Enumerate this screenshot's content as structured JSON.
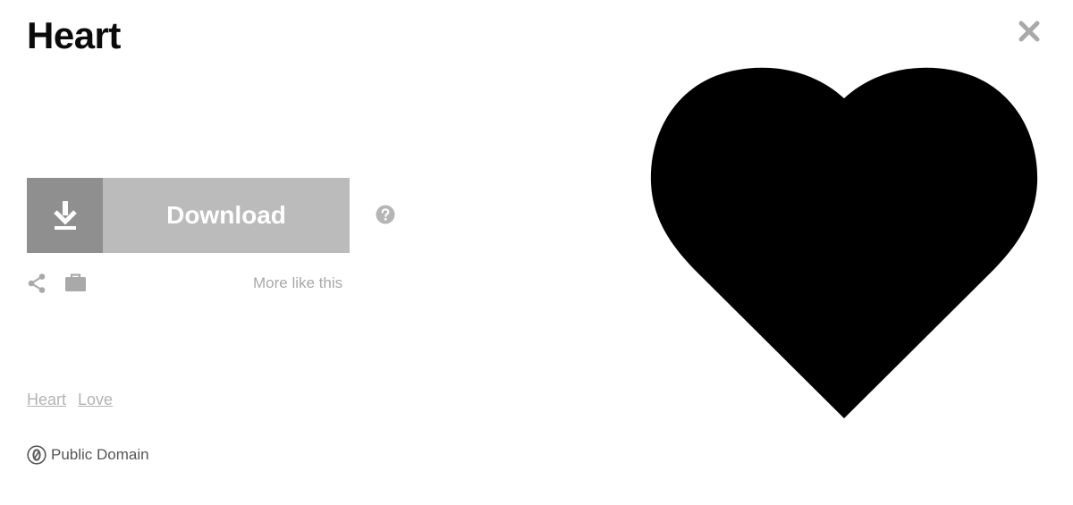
{
  "header": {
    "title": "Heart"
  },
  "actions": {
    "download_label": "Download",
    "more_like_this": "More like this"
  },
  "tags": [
    "Heart",
    "Love"
  ],
  "license": {
    "label": "Public Domain"
  },
  "icons": {
    "close": "close-icon",
    "download": "download-arrow-icon",
    "help": "help-icon",
    "share": "share-icon",
    "collection": "briefcase-icon",
    "public_domain": "public-domain-icon"
  },
  "colors": {
    "download_icon_bg": "#8f8f8f",
    "download_bg": "#bbbbbb",
    "muted_text": "#a8a8a8",
    "heart_fill": "#000000"
  }
}
